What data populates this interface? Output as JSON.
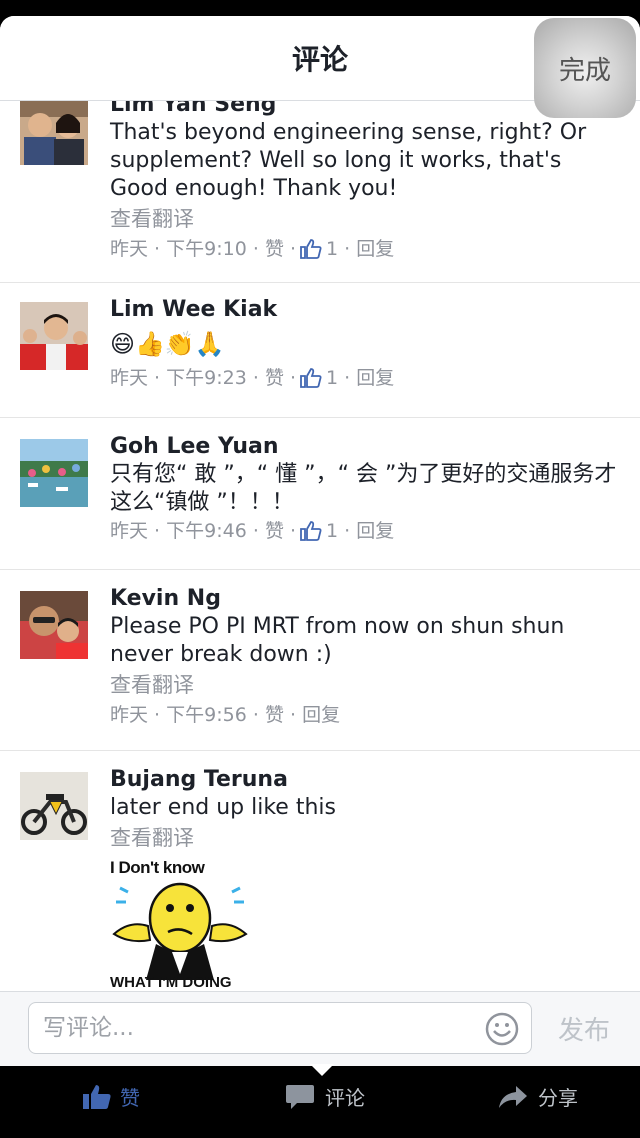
{
  "header": {
    "title": "评论",
    "done_label": "完成"
  },
  "comments": [
    {
      "author": "Lim Yan Seng",
      "text": "That's beyond engineering sense, right? Or supplement? Well so long it works, that's Good enough! Thank you!",
      "translate": "查看翻译",
      "meta": {
        "day": "昨天",
        "time": "下午9:10",
        "like": "赞",
        "likes": "1",
        "reply": "回复"
      }
    },
    {
      "author": "Lim Wee Kiak",
      "text": "😄👍👏🙏",
      "meta": {
        "day": "昨天",
        "time": "下午9:23",
        "like": "赞",
        "likes": "1",
        "reply": "回复"
      }
    },
    {
      "author": "Goh Lee Yuan",
      "text": "只有您“ 敢 ”，“ 懂 ”，“ 会 ”为了更好的交通服务才 这么“镇做 ”！！！",
      "meta": {
        "day": "昨天",
        "time": "下午9:46",
        "like": "赞",
        "likes": "1",
        "reply": "回复"
      }
    },
    {
      "author": "Kevin Ng",
      "text": "Please PO PI MRT from now on shun shun never break down :)",
      "translate": "查看翻译",
      "meta": {
        "day": "昨天",
        "time": "下午9:56",
        "like": "赞",
        "reply": "回复"
      }
    },
    {
      "author": "Bujang Teruna",
      "text": "later end up like this",
      "translate": "查看翻译",
      "sticker": {
        "top": "I Don't know",
        "bottom": "WHAT I'M DOING"
      }
    }
  ],
  "composer": {
    "placeholder": "写评论...",
    "post_label": "发布"
  },
  "bottombar": {
    "like_label": "赞",
    "comment_label": "评论",
    "share_label": "分享"
  },
  "colors": {
    "link_gray": "#90949c",
    "brand_blue": "#4267b2",
    "sticker_yellow": "#f7e33a"
  }
}
